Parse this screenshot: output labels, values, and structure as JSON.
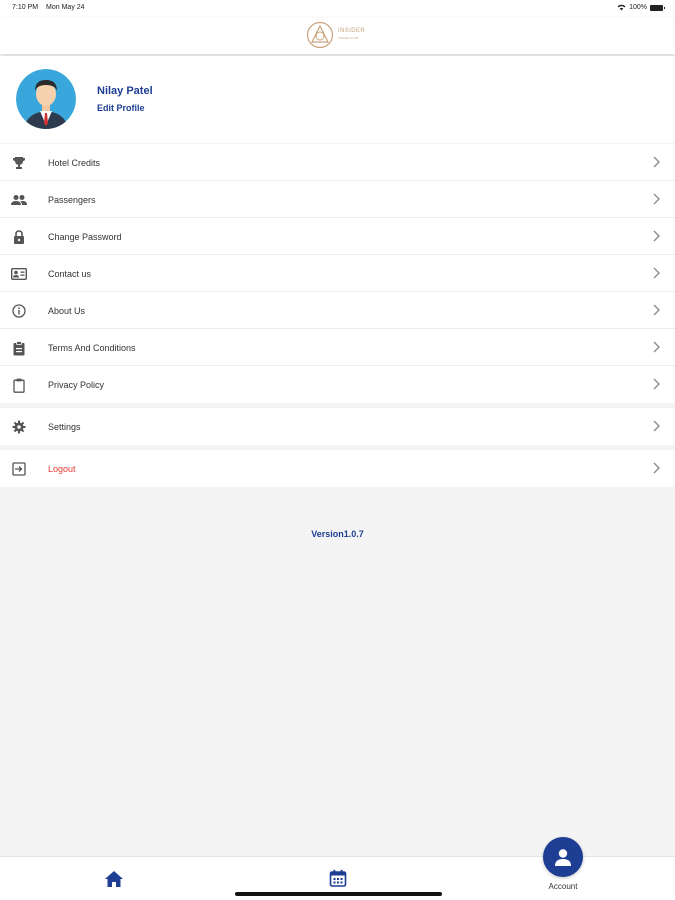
{
  "status_bar": {
    "time": "7:10 PM",
    "date": "Mon May 24",
    "battery": "100%"
  },
  "header": {
    "logo_name": "INSIDER",
    "logo_tagline": "TRAVEL CLUB"
  },
  "profile": {
    "name": "Nilay Patel",
    "edit_label": "Edit Profile"
  },
  "menu": {
    "main": [
      {
        "label": "Hotel Credits",
        "icon": "trophy-icon"
      },
      {
        "label": "Passengers",
        "icon": "people-icon"
      },
      {
        "label": "Change Password",
        "icon": "lock-icon"
      },
      {
        "label": "Contact us",
        "icon": "contact-card-icon"
      },
      {
        "label": "About Us",
        "icon": "info-icon"
      },
      {
        "label": "Terms And Conditions",
        "icon": "clipboard-icon"
      },
      {
        "label": "Privacy Policy",
        "icon": "clipboard-blank-icon"
      }
    ],
    "settings": {
      "label": "Settings",
      "icon": "gear-icon"
    },
    "logout": {
      "label": "Logout",
      "icon": "logout-icon"
    }
  },
  "version": "Version1.0.7",
  "tabbar": {
    "account_label": "Account"
  },
  "colors": {
    "brand": "#1d3e93",
    "logout": "#e53935",
    "logo_gold": "#c9a37d",
    "background": "#f4f4f5"
  }
}
